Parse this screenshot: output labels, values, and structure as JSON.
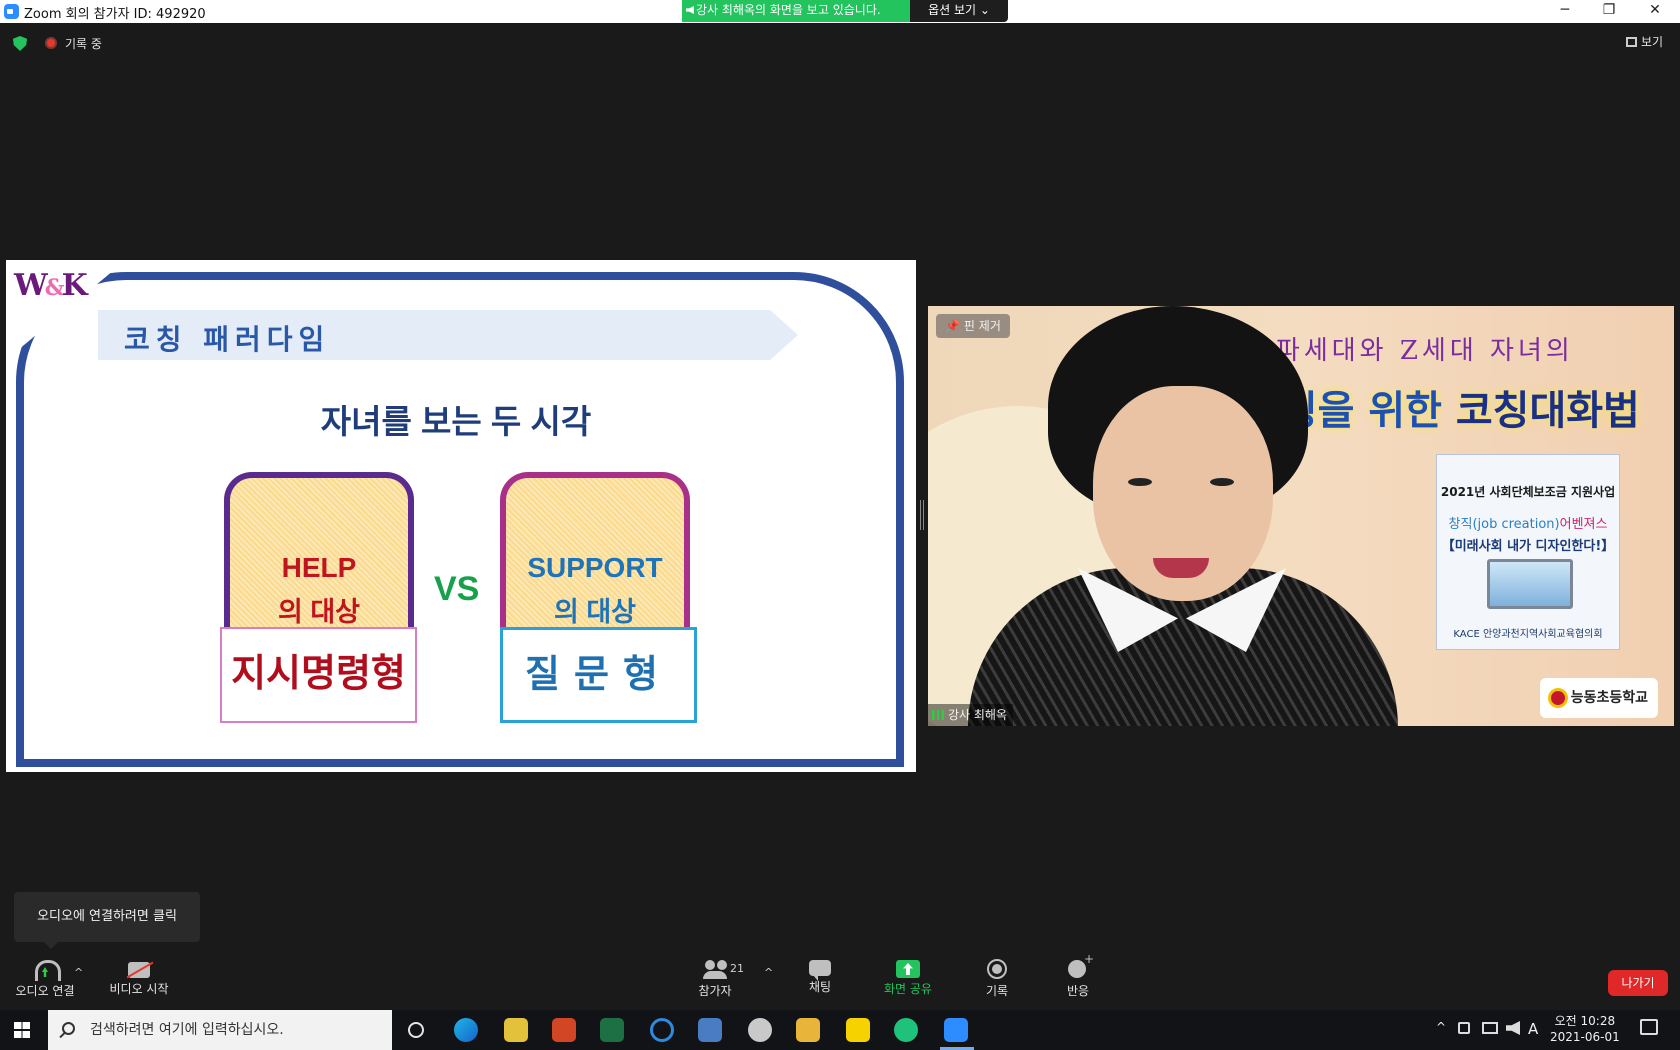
{
  "window": {
    "title": "Zoom 회의 참가자 ID: 492920",
    "share_banner": "강사 최해옥의 화면을 보고 있습니다.",
    "view_options": "옵션 보기 ⌄",
    "minimize": "─",
    "restore": "❐",
    "close": "✕"
  },
  "meeting": {
    "recording_label": "기록 중",
    "view_label": "보기"
  },
  "slide": {
    "logo": "W",
    "logo_amp": "&",
    "logo_k": "K",
    "ribbon": "코칭 패러다임",
    "title": "자녀를 보는 두 시각",
    "help_line1": "HELP",
    "help_line2": "의 대상",
    "vs": "VS",
    "support_line1": "SUPPORT",
    "support_line2": "의 대상",
    "box_direct": "지시명령형",
    "box_ask": "질문형"
  },
  "video": {
    "pin_remove": "핀 제거",
    "name": "강사 최해옥",
    "bg_line1": "알파세대와 Z세대 자녀의",
    "bg_line2a": "코칭을 위한 ",
    "bg_line2b": "코칭대화법",
    "poster_line1": "2021년 사회단체보조금 지원사업",
    "poster_line2a": "창직(job creation)",
    "poster_line2b": "어벤져스",
    "poster_line3": "【미래사회 내가 디자인한다!】",
    "poster_line4": "KACE 안양과천지역사회교육협의회",
    "school": "능동초등학교"
  },
  "tooltip": {
    "text": "오디오에 연결하려면 클릭"
  },
  "controls": {
    "audio": "오디오 연결",
    "video": "비디오 시작",
    "participants": "참가자",
    "participant_count": "21",
    "chat": "채팅",
    "share": "화면 공유",
    "record": "기록",
    "reactions": "반응",
    "leave": "나가기",
    "caret": "^"
  },
  "taskbar": {
    "search_placeholder": "검색하려면 여기에 입력하십시오.",
    "ime": "A",
    "time": "오전 10:28",
    "date": "2021-06-01"
  },
  "colors": {
    "accent_green": "#23c35e",
    "leave_red": "#e02828",
    "slide_frame": "#2f4f9c"
  }
}
